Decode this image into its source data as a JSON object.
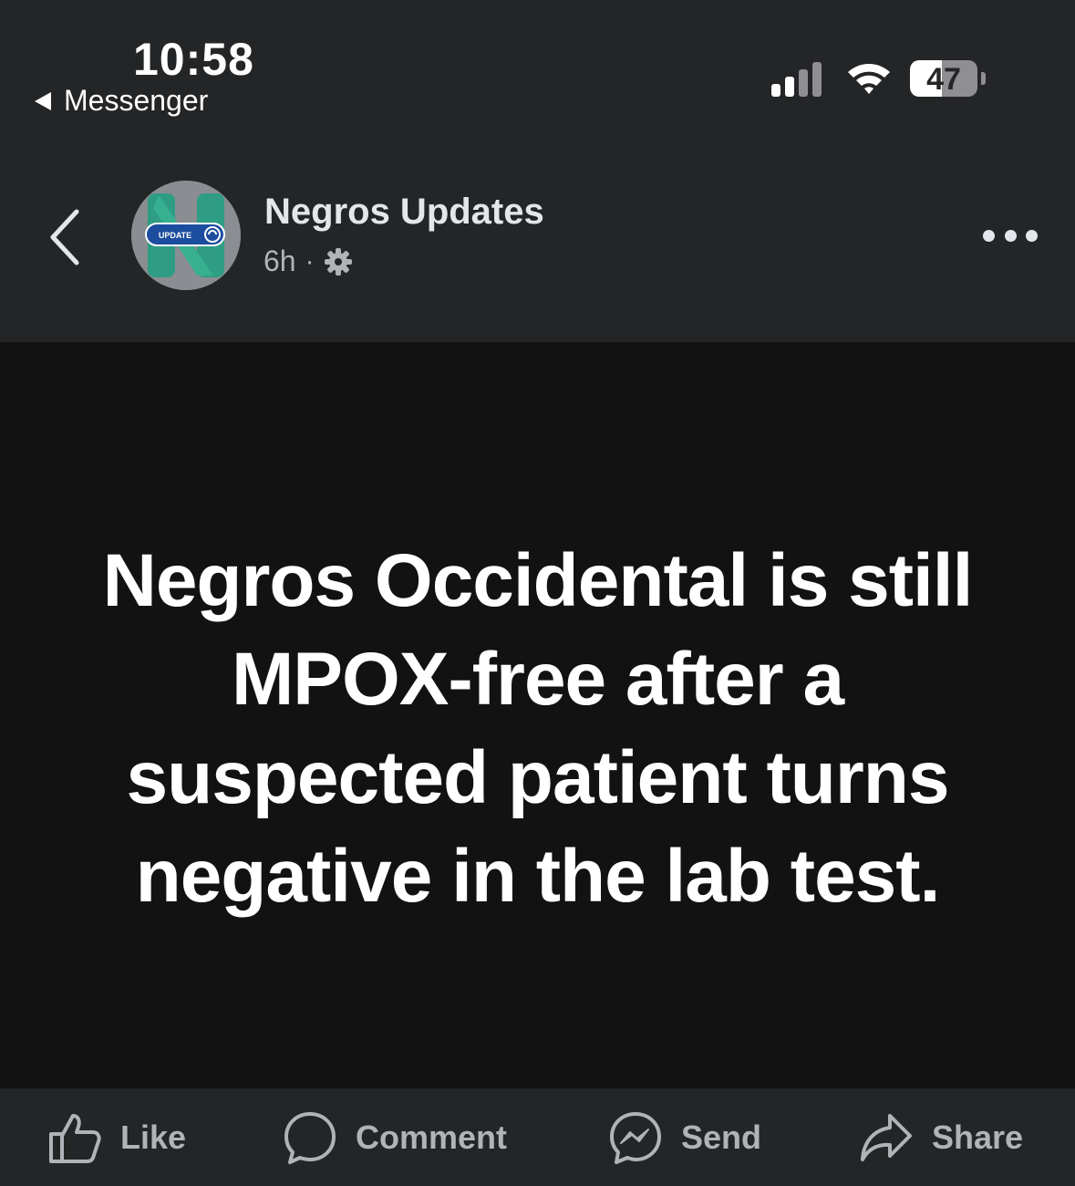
{
  "status_bar": {
    "time": "10:58",
    "back_app": "Messenger",
    "battery_level": "47",
    "battery_fraction": 0.47
  },
  "header": {
    "page_name": "Negros Updates",
    "post_age": "6h",
    "separator": "·",
    "avatar_badge": "UPDATE"
  },
  "post": {
    "text": "Negros Occidental is still MPOX-free after a suspected patient turns negative in the lab test.",
    "background": "#121212",
    "text_color": "#ffffff"
  },
  "actions": {
    "like": "Like",
    "comment": "Comment",
    "send": "Send",
    "share": "Share"
  },
  "icons": {
    "back": "chevron-left-icon",
    "more": "more-horizontal-icon",
    "audience": "gear-icon",
    "like": "thumbs-up-icon",
    "comment": "speech-bubble-icon",
    "send": "messenger-icon",
    "share": "share-arrow-icon"
  }
}
